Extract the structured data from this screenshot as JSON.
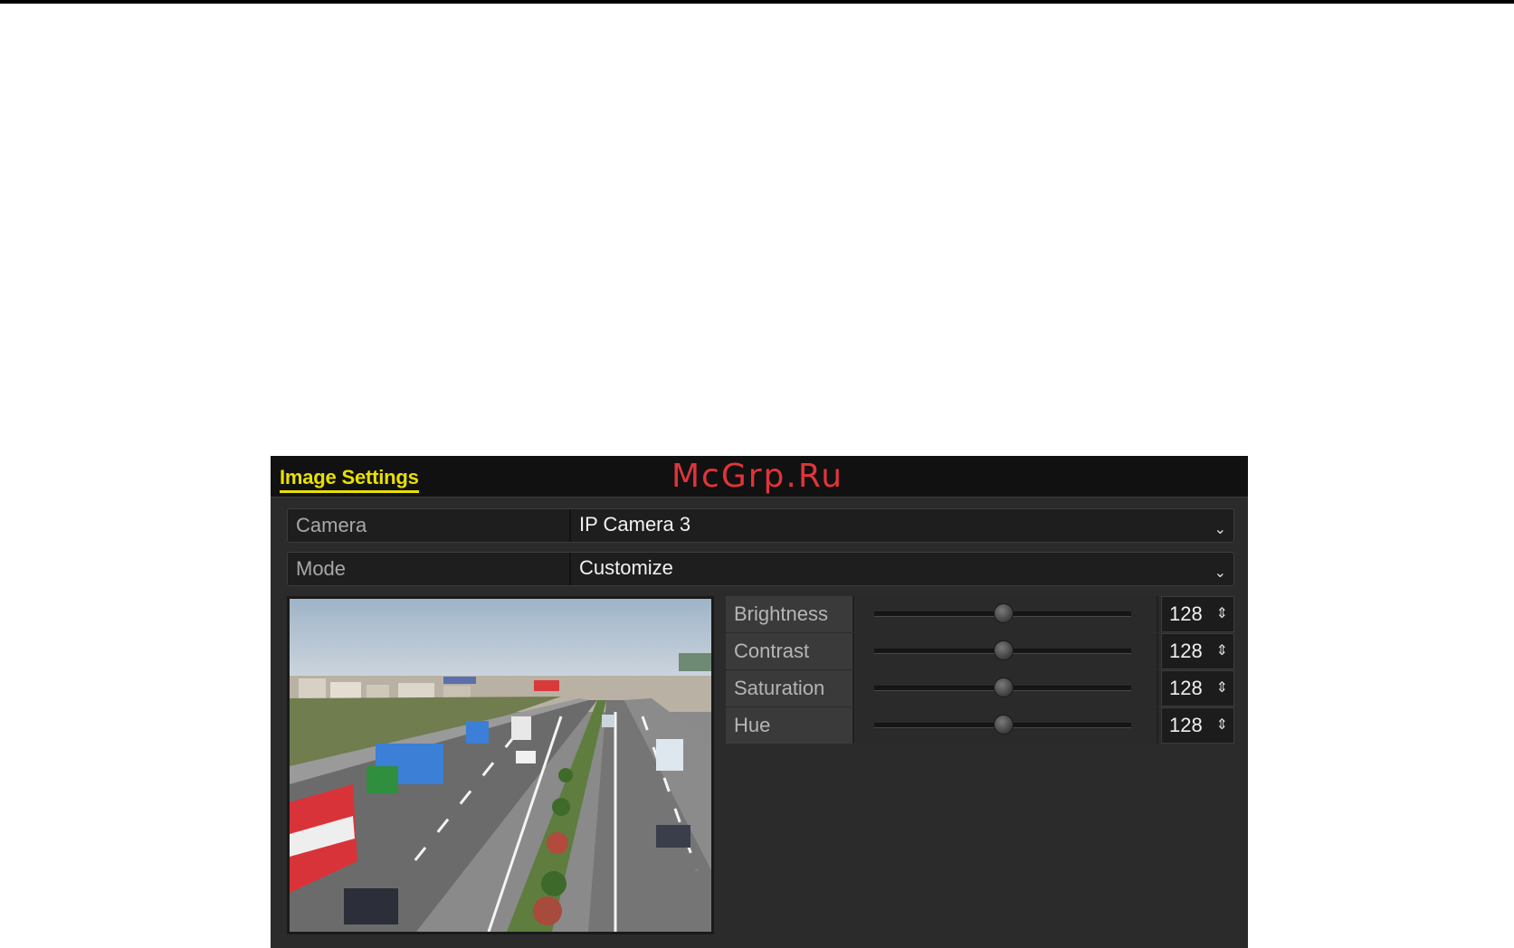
{
  "window": {
    "title": "Image Settings",
    "watermark": "McGrp.Ru"
  },
  "fields": {
    "camera": {
      "label": "Camera",
      "value": "IP Camera 3"
    },
    "mode": {
      "label": "Mode",
      "value": "Customize"
    }
  },
  "adjustments": [
    {
      "label": "Brightness",
      "value": "128",
      "level": 0.5
    },
    {
      "label": "Contrast",
      "value": "128",
      "level": 0.5
    },
    {
      "label": "Saturation",
      "value": "128",
      "level": 0.5
    },
    {
      "label": "Hue",
      "value": "128",
      "level": 0.5
    }
  ],
  "icons": {
    "dropdown": "chevron-down-icon",
    "spinner": "spinner-arrows-icon"
  },
  "colors": {
    "title": "#e8e000",
    "panel": "#2b2b2b",
    "watermark": "#e0343a"
  }
}
